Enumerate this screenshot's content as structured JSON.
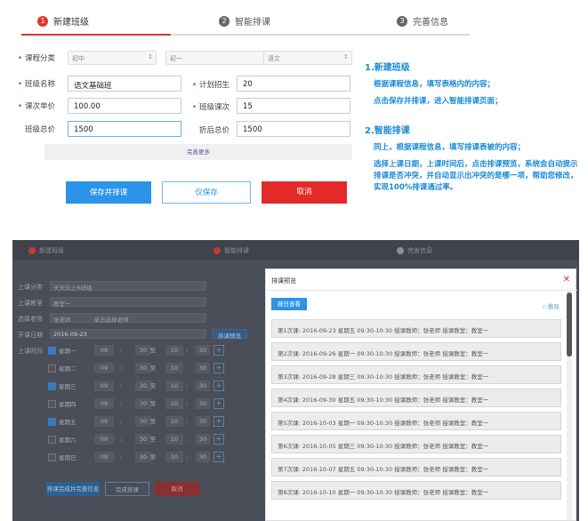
{
  "steps": [
    {
      "num": "1",
      "label": "新建班级"
    },
    {
      "num": "2",
      "label": "智能排课"
    },
    {
      "num": "3",
      "label": "完善信息"
    }
  ],
  "form": {
    "category_label": "课程分类",
    "category_values": [
      "初中",
      "初一",
      "语文"
    ],
    "class_name_label": "班级名称",
    "class_name_value": "语文基础班",
    "plan_label": "计划招生",
    "plan_value": "20",
    "unit_price_label": "课次单价",
    "unit_price_value": "100.00",
    "class_lessons_label": "班级课次",
    "class_lessons_value": "15",
    "total_label": "班级总价",
    "total_value": "1500",
    "discount_label": "折后总价",
    "discount_value": "1500",
    "more_label": "完善更多",
    "save_schedule": "保存并排课",
    "save_only": "仅保存",
    "cancel": "取消"
  },
  "instructions": {
    "h1": "1.新建班级",
    "p1a": "根据课程信息，填写表格内的内容；",
    "p1b": "点击保存并排课，进入智能排课页面；",
    "h2": "2.智能排课",
    "p2a": "同上，根据课程信息，填写排课表被的内容；",
    "p2b": "选择上课日期，上课时间后，点击排课预览，系统会自动提示排课是否冲突，并自动显示出冲突的是哪一项，帮助您修改，实现100%排课通过率。"
  },
  "bottom": {
    "tabs": [
      "新建班级",
      "智能排课",
      "完善信息"
    ],
    "fields": [
      {
        "label": "上课分类",
        "value": "天天向上R班级"
      },
      {
        "label": "上课教室",
        "value": "教室一"
      },
      {
        "label": "选择老师",
        "value": "张老师"
      },
      {
        "label": "开课日期",
        "value": "2016-09-23"
      },
      {
        "label": "上课时间",
        "value": ""
      }
    ],
    "teacher_hint": "单击选择老师",
    "preview_button": "排课预览",
    "days": [
      {
        "day": "星期一",
        "checked": true
      },
      {
        "day": "星期二",
        "checked": false
      },
      {
        "day": "星期三",
        "checked": true
      },
      {
        "day": "星期四",
        "checked": false
      },
      {
        "day": "星期五",
        "checked": true
      },
      {
        "day": "星期六",
        "checked": false
      },
      {
        "day": "星期日",
        "checked": false
      }
    ],
    "time_cells": [
      "09",
      ":",
      "30",
      "至",
      "10",
      ":",
      "30"
    ],
    "bottom_buttons": [
      "排课完成并完善信息",
      "完成排课",
      "取消"
    ]
  },
  "modal": {
    "title": "排课预览",
    "view_button": "按日查看",
    "delete_label": "删除",
    "items": [
      "第1次课:  2016-09-23   星期五   09:30-10:30   授课教师：张老师   授课教室：教室一",
      "第2次课:  2016-09-26   星期一   09:30-10:30   授课教师：张老师   授课教室：教室一",
      "第3次课:  2016-09-28   星期三   09:30-10:30   授课教师：张老师   授课教室：教室一",
      "第4次课:  2016-09-30   星期五   09:30-10:30   授课教师：张老师   授课教室：教室一",
      "第5次课:  2016-10-03   星期一   09:30-10:30   授课教师：张老师   授课教室：教室一",
      "第6次课:  2016-10-05   星期三   09:30-10:30   授课教师：张老师   授课教室：教室一",
      "第7次课:  2016-10-07   星期五   09:30-10:30   授课教师：张老师   授课教室：教室一",
      "第8次课:  2016-10-10   星期一   09:30-10:30   授课教师：张老师   授课教室：教室一"
    ]
  }
}
